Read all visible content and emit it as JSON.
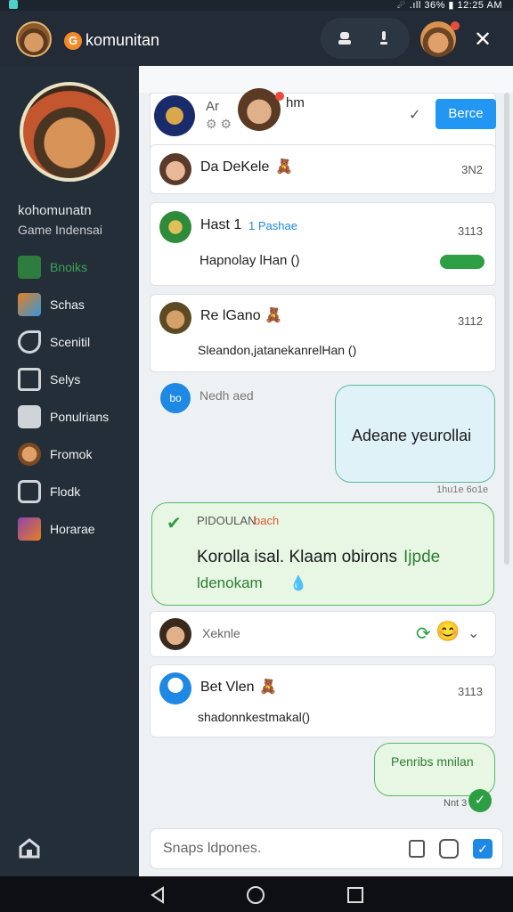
{
  "status": {
    "right": "☄ .ıll 36% ▮ 12:25 AM"
  },
  "appbar": {
    "logo_letter": "G",
    "title": "komunitan",
    "icons": [
      "person-icon",
      "alert-icon",
      "close-icon"
    ]
  },
  "sidebar": {
    "community_name": "kohomunatn",
    "community_sub": "Game Indensai",
    "items": [
      {
        "label": "Bnoiks",
        "icon": "grid-icon",
        "active": true
      },
      {
        "label": "Schas",
        "icon": "game-icon",
        "active": false
      },
      {
        "label": "Scenitil",
        "icon": "bird-icon",
        "active": false
      },
      {
        "label": "Selys",
        "icon": "music-icon",
        "active": false
      },
      {
        "label": "Ponulrians",
        "icon": "camera-icon",
        "active": false
      },
      {
        "label": "Fromok",
        "icon": "avatar-icon",
        "active": false
      },
      {
        "label": "Flodk",
        "icon": "layers-icon",
        "active": false
      },
      {
        "label": "Horarae",
        "icon": "picture-icon",
        "active": false
      }
    ]
  },
  "main": {
    "header": {
      "name": "Ar",
      "name2": "hm",
      "button": "Berce"
    },
    "cards": [
      {
        "name": "Da DeKele",
        "num": "3N2"
      },
      {
        "name": "Hast 1",
        "tag": "1 Pashae",
        "num": "3113",
        "msg": "Hapnolay lHan ()"
      },
      {
        "name": "Re lGano",
        "num": "3112",
        "msg": "Sleandon,jatanekanrelHan ()"
      }
    ],
    "reply_row": {
      "badge": "bo",
      "text": "Nedh aed"
    },
    "bubble_blue": {
      "text": "Adeane yeurollai",
      "meta": "1hu1e 6o1e"
    },
    "bubble_green": {
      "header": "PIDOULAN",
      "header_tag": "bach",
      "line1": "Korolla isal. Klaam obirons",
      "line1_accent": "Ijpde",
      "line2": "ldenokam"
    },
    "reaction_row": {
      "name": "Xeknle"
    },
    "card4": {
      "name": "Bet Vlen",
      "num": "3113",
      "msg": "shadonnkestmakal()"
    },
    "bubble_small": {
      "text": "Penribs mnilan",
      "meta": "Nnt 3"
    },
    "composer": {
      "placeholder": "Snaps ldpones."
    }
  }
}
